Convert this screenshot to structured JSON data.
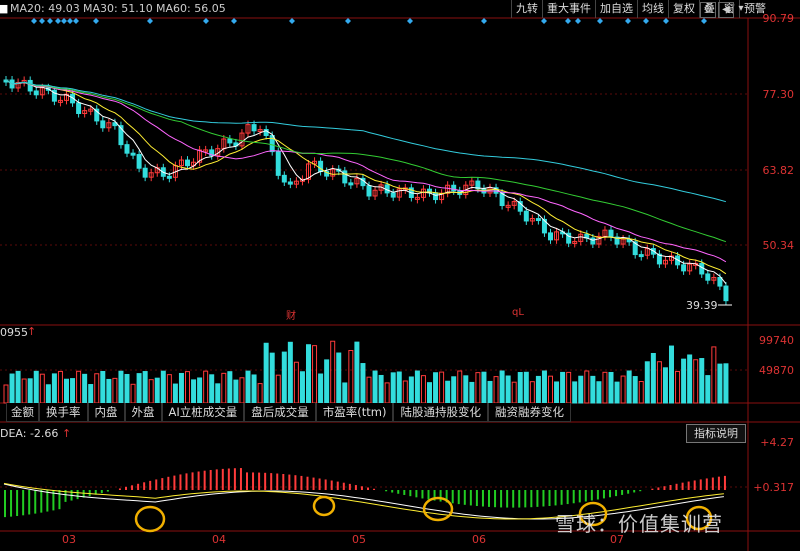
{
  "header": {
    "ma_lines": [
      {
        "label": "MA20: 49.03",
        "color": "#ff66ff"
      },
      {
        "label": "MA30: 51.10",
        "color": "#33cc33"
      },
      {
        "label": "MA60: 56.05",
        "color": "#33ccdd"
      }
    ],
    "first_ma_partial": "",
    "toolbar": [
      "九转",
      "重大事件",
      "加自选",
      "均线",
      "复权",
      "叠",
      "窗",
      "预警"
    ]
  },
  "price_axis": [
    "90.79",
    "77.30",
    "63.82",
    "50.34"
  ],
  "last_price": "39.39",
  "event_markers": [
    "财",
    "qL"
  ],
  "volume": {
    "left_label": "0955",
    "axis": [
      "99740",
      "49870"
    ]
  },
  "tabs": [
    "金额",
    "换手率",
    "内盘",
    "外盘",
    "AI立桩成交量",
    "盘后成交量",
    "市盈率(ttm)",
    "陆股通持股变化",
    "融资融券变化"
  ],
  "macd": {
    "label": "DEA: -2.66",
    "axis": [
      "+4.27",
      "+0.317"
    ],
    "button": "指标说明"
  },
  "dates": [
    "03",
    "04",
    "05",
    "06",
    "07"
  ],
  "watermark": "雪球：价值集训营",
  "colors": {
    "up": "#ff3b3b",
    "down": "#33dddd",
    "grid": "#8a1010",
    "ma5": "#ffffff",
    "ma10": "#ffee33",
    "ma20": "#ff66ff",
    "ma30": "#33cc33",
    "ma60": "#33ccdd"
  }
}
